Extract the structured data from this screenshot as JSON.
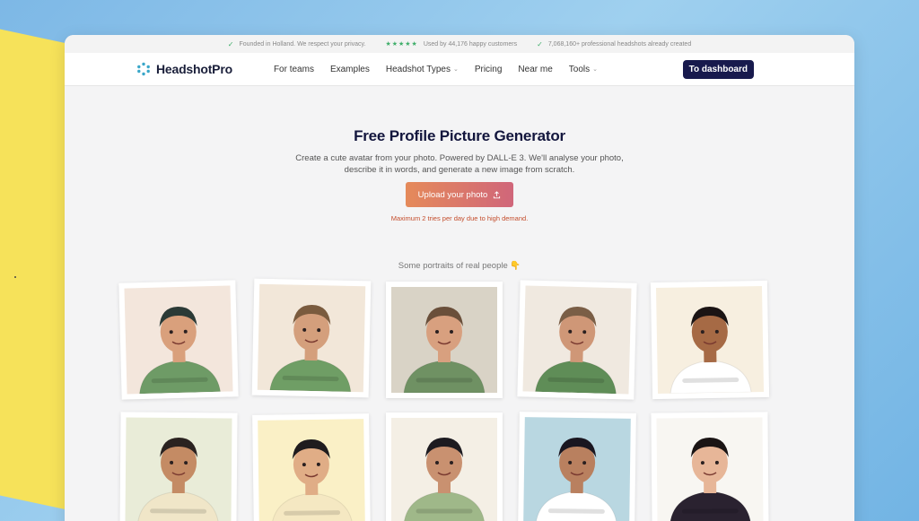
{
  "topbar": {
    "items": [
      {
        "icon": "check-icon",
        "text": "Founded in Holland. We respect your privacy."
      },
      {
        "icon": "stars-icon",
        "stars": "★★★★★",
        "text": "Used by 44,176 happy customers"
      },
      {
        "icon": "check-icon",
        "text": "7,068,160+ professional headshots already created"
      }
    ]
  },
  "nav": {
    "logo": "HeadshotPro",
    "links": [
      "For teams",
      "Examples",
      "Headshot Types",
      "Pricing",
      "Near me",
      "Tools"
    ],
    "dashboard": "To dashboard"
  },
  "hero": {
    "title": "Free Profile Picture Generator",
    "desc_line1": "Create a cute avatar from your photo. Powered by DALL-E 3. We'll analyse your photo,",
    "desc_line2": "describe it in words, and generate a new image from scratch.",
    "upload": "Upload your photo",
    "limit": "Maximum 2 tries per day due to high demand.",
    "portraits_title": "Some portraits of real people 👇"
  },
  "colors": {
    "accent_navy": "#181a4d",
    "upload_start": "#e58a5a",
    "upload_end": "#d0667a",
    "warning": "#c44d2c"
  },
  "portraits": [
    {
      "bg": "#f3e6dc",
      "shirt": "#6e9b66",
      "skin": "#d9a07c",
      "hair": "#2b3a36"
    },
    {
      "bg": "#f2e7d9",
      "shirt": "#6f9e65",
      "skin": "#d49f7c",
      "hair": "#7a5b3e"
    },
    {
      "bg": "#d9d3c6",
      "shirt": "#6f9163",
      "skin": "#d8a07f",
      "hair": "#6a4f3a"
    },
    {
      "bg": "#f0e9e0",
      "shirt": "#5f8d57",
      "skin": "#cf9777",
      "hair": "#7a5e46"
    },
    {
      "bg": "#f7efe0",
      "shirt": "#ffffff",
      "skin": "#a66a45",
      "hair": "#1b1414"
    },
    {
      "bg": "#e9ecd8",
      "shirt": "#f0e6c8",
      "skin": "#c48b64",
      "hair": "#2a2220"
    },
    {
      "bg": "#faf0c6",
      "shirt": "#f5e8c2",
      "skin": "#e0ad86",
      "hair": "#1f1c1e"
    },
    {
      "bg": "#f4efe5",
      "shirt": "#9fb889",
      "skin": "#c99170",
      "hair": "#1d1b20"
    },
    {
      "bg": "#b9d7e1",
      "shirt": "#ffffff",
      "skin": "#b9805f",
      "hair": "#1a1620"
    },
    {
      "bg": "#f8f6f2",
      "shirt": "#2a2230",
      "skin": "#e7b698",
      "hair": "#1a1414"
    }
  ]
}
